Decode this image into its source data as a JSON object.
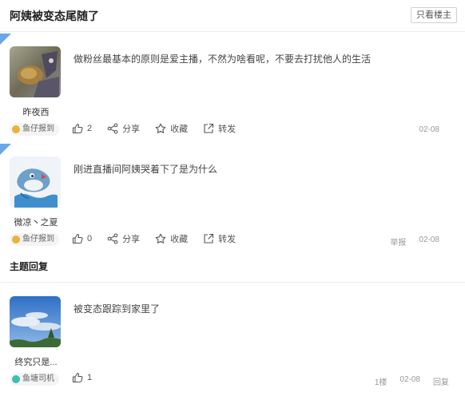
{
  "header": {
    "title": "阿姨被变态尾随了",
    "only_host_label": "只看楼主"
  },
  "posts": [
    {
      "username": "昨夜西",
      "content": "做粉丝最基本的原则是爱主播，不然为啥看呢，不要去打扰他人的生活",
      "badge": "鱼仔报到",
      "likes": "2",
      "share_label": "分享",
      "collect_label": "收藏",
      "forward_label": "转发",
      "date": "02-08"
    },
    {
      "username": "微凉丶之夏",
      "content": "刚进直播间阿姨哭着下了是为什么",
      "badge": "鱼仔报到",
      "likes": "0",
      "share_label": "分享",
      "collect_label": "收藏",
      "forward_label": "转发",
      "report_label": "举报",
      "date": "02-08"
    }
  ],
  "replies_section": {
    "title": "主题回复",
    "replies": [
      {
        "username": "终究只是...",
        "content": "被变态跟踪到家里了",
        "badge": "鱼塘司机",
        "likes": "1",
        "floor": "1楼",
        "date": "02-08",
        "reply_label": "回复"
      }
    ]
  },
  "colors": {
    "corner": "#6aa6e8",
    "badge_gold": "#e9b23c",
    "badge_teal": "#3ebfb0"
  }
}
